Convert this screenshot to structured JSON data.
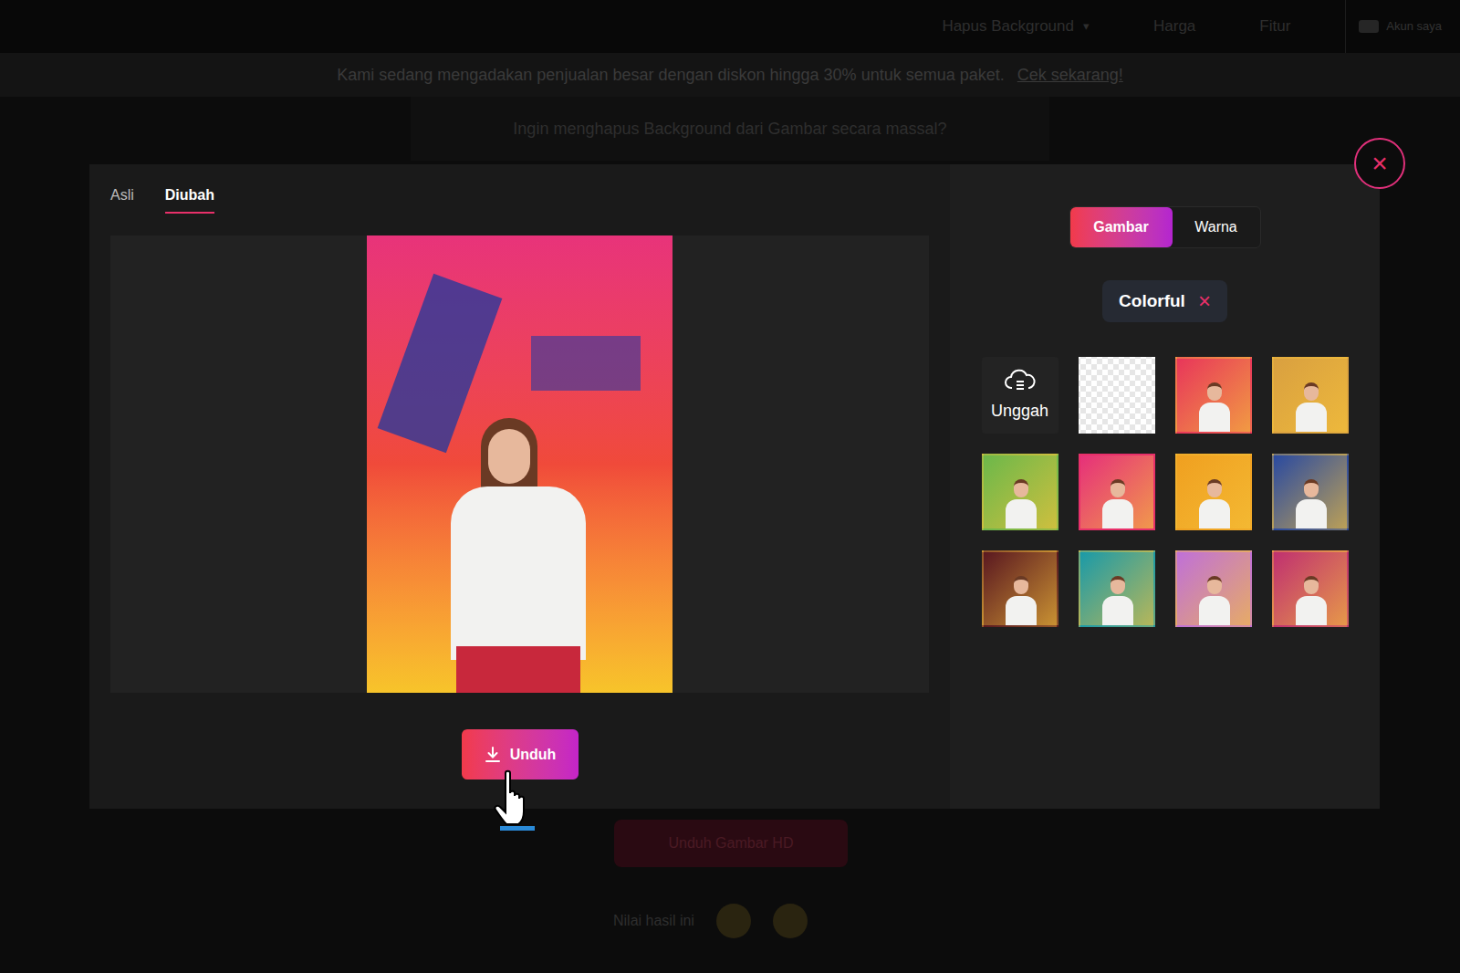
{
  "nav": {
    "items": [
      {
        "label": "Hapus Background",
        "caret": "▾"
      },
      {
        "label": "Harga",
        "caret": ""
      },
      {
        "label": "Fitur",
        "caret": ""
      }
    ],
    "account": "Akun saya"
  },
  "banner": {
    "text": "Kami sedang mengadakan penjualan besar dengan diskon hingga 30% untuk semua paket.",
    "link": "Cek sekarang!"
  },
  "page": {
    "heading": "Ingin menghapus Background dari Gambar secara massal?",
    "hd_button": "Unduh Gambar HD",
    "rating_label": "Nilai hasil ini"
  },
  "modal": {
    "close": "×",
    "view_tabs": [
      {
        "label": "Asli",
        "selected": false
      },
      {
        "label": "Diubah",
        "selected": true
      }
    ],
    "download": "Unduh",
    "mode_tabs": [
      {
        "label": "Gambar",
        "selected": true
      },
      {
        "label": "Warna",
        "selected": false
      }
    ],
    "category": {
      "label": "Colorful",
      "clear": "×"
    },
    "upload": "Unggah",
    "backgrounds": [
      {
        "kind": "transparent",
        "selected": false,
        "color": "#ffffff"
      },
      {
        "kind": "image",
        "selected": false,
        "color": "#e8365a"
      },
      {
        "kind": "image",
        "selected": false,
        "color": "#d9a040"
      },
      {
        "kind": "image",
        "selected": false,
        "color": "#6cb84a"
      },
      {
        "kind": "image",
        "selected": true,
        "color": "#e6307a"
      },
      {
        "kind": "image",
        "selected": false,
        "color": "#f0a020"
      },
      {
        "kind": "image",
        "selected": false,
        "color": "#2a4aa0"
      },
      {
        "kind": "image",
        "selected": false,
        "color": "#5a1820"
      },
      {
        "kind": "image",
        "selected": false,
        "color": "#1a9aa8"
      },
      {
        "kind": "image",
        "selected": false,
        "color": "#c070d8"
      },
      {
        "kind": "image",
        "selected": false,
        "color": "#c03070"
      }
    ]
  }
}
